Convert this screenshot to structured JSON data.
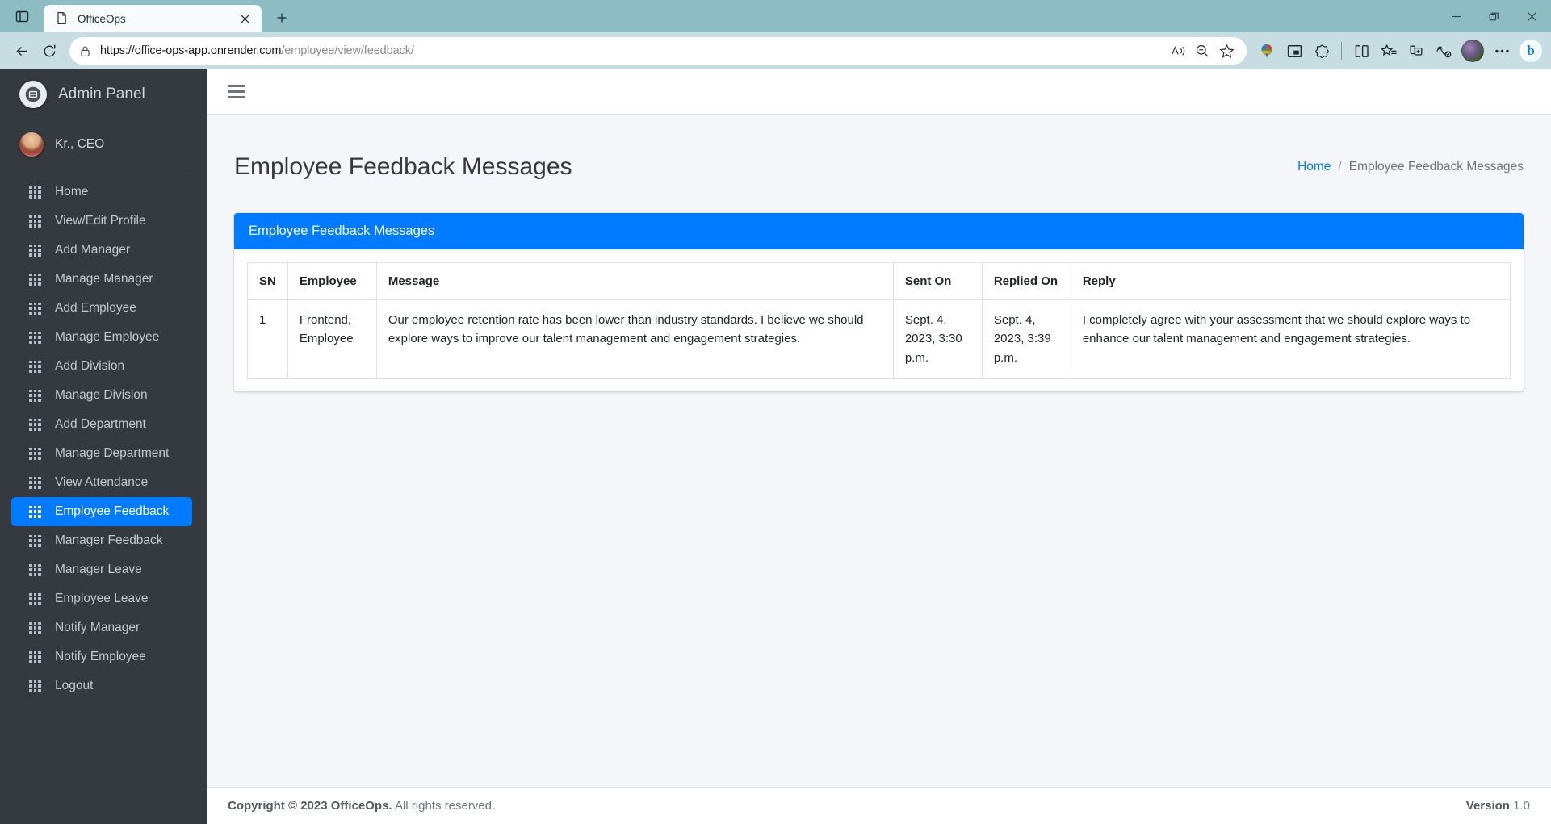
{
  "browser": {
    "tab": {
      "title": "OfficeOps",
      "favicon_icon": "page-icon",
      "close_icon": "close-icon"
    },
    "tab_strip_icon": "tab-list-icon",
    "new_tab_label": "+",
    "window_controls": {
      "minimize": "minimize-icon",
      "maximize": "restore-icon",
      "close": "close-icon"
    },
    "nav": {
      "back_icon": "back-arrow-icon",
      "reload_icon": "reload-icon"
    },
    "url": {
      "lock_icon": "lock-icon",
      "full": "https://office-ops-app.onrender.com/employee/view/feedback/",
      "host": "https://office-ops-app.onrender.com",
      "path": "/employee/view/feedback/"
    },
    "url_actions": [
      {
        "name": "read-aloud-icon",
        "label": "A"
      },
      {
        "name": "zoom-out-icon",
        "label": ""
      },
      {
        "name": "favorite-star-icon",
        "label": ""
      }
    ],
    "toolbar_actions": [
      {
        "name": "idm-extension-icon",
        "label": ""
      },
      {
        "name": "picture-in-picture-icon",
        "label": ""
      },
      {
        "name": "browser-essentials-icon",
        "label": ""
      },
      {
        "name": "split-screen-icon",
        "label": ""
      },
      {
        "name": "favorites-icon",
        "label": ""
      },
      {
        "name": "collections-icon",
        "label": ""
      },
      {
        "name": "performance-icon",
        "label": ""
      },
      {
        "name": "profile-avatar",
        "label": ""
      },
      {
        "name": "settings-more-icon",
        "label": "…"
      },
      {
        "name": "copilot-bing-icon",
        "label": "b"
      }
    ]
  },
  "sidebar": {
    "brand": {
      "label": "Admin Panel",
      "logo_icon": "app-logo-icon"
    },
    "user": {
      "name": "Kr., CEO",
      "avatar_icon": "user-avatar"
    },
    "items": [
      {
        "label": "Home",
        "icon": "grid-icon",
        "active": false
      },
      {
        "label": "View/Edit Profile",
        "icon": "grid-icon",
        "active": false
      },
      {
        "label": "Add Manager",
        "icon": "grid-icon",
        "active": false
      },
      {
        "label": "Manage Manager",
        "icon": "grid-icon",
        "active": false
      },
      {
        "label": "Add Employee",
        "icon": "grid-icon",
        "active": false
      },
      {
        "label": "Manage Employee",
        "icon": "grid-icon",
        "active": false
      },
      {
        "label": "Add Division",
        "icon": "grid-icon",
        "active": false
      },
      {
        "label": "Manage Division",
        "icon": "grid-icon",
        "active": false
      },
      {
        "label": "Add Department",
        "icon": "grid-icon",
        "active": false
      },
      {
        "label": "Manage Department",
        "icon": "grid-icon",
        "active": false
      },
      {
        "label": "View Attendance",
        "icon": "grid-icon",
        "active": false
      },
      {
        "label": "Employee Feedback",
        "icon": "grid-icon",
        "active": true
      },
      {
        "label": "Manager Feedback",
        "icon": "grid-icon",
        "active": false
      },
      {
        "label": "Manager Leave",
        "icon": "grid-icon",
        "active": false
      },
      {
        "label": "Employee Leave",
        "icon": "grid-icon",
        "active": false
      },
      {
        "label": "Notify Manager",
        "icon": "grid-icon",
        "active": false
      },
      {
        "label": "Notify Employee",
        "icon": "grid-icon",
        "active": false
      },
      {
        "label": "Logout",
        "icon": "grid-icon",
        "active": false
      }
    ]
  },
  "topnav": {
    "menu_toggle_icon": "hamburger-icon"
  },
  "page": {
    "title": "Employee Feedback Messages",
    "breadcrumb": {
      "home": "Home",
      "separator": "/",
      "current": "Employee Feedback Messages"
    }
  },
  "card": {
    "header": "Employee Feedback Messages",
    "table": {
      "columns": [
        "SN",
        "Employee",
        "Message",
        "Sent On",
        "Replied On",
        "Reply"
      ],
      "rows": [
        {
          "sn": "1",
          "employee": "Frontend, Employee",
          "message": "Our employee retention rate has been lower than industry standards. I believe we should explore ways to improve our talent management and engagement strategies.",
          "sent_on": "Sept. 4, 2023, 3:30 p.m.",
          "replied_on": "Sept. 4, 2023, 3:39 p.m.",
          "reply": "I completely agree with your assessment that we should explore ways to enhance our talent management and engagement strategies."
        }
      ]
    }
  },
  "footer": {
    "copyright_strong": "Copyright © 2023 OfficeOps.",
    "copyright_rest": " All rights reserved.",
    "version_label": "Version",
    "version_value": "1.0"
  },
  "colors": {
    "brand_blue": "#007bff",
    "sidebar_dark": "#343a40",
    "chrome_teal": "#8ebcc3",
    "page_bg": "#f4f6f9",
    "link_blue": "#007bff"
  }
}
